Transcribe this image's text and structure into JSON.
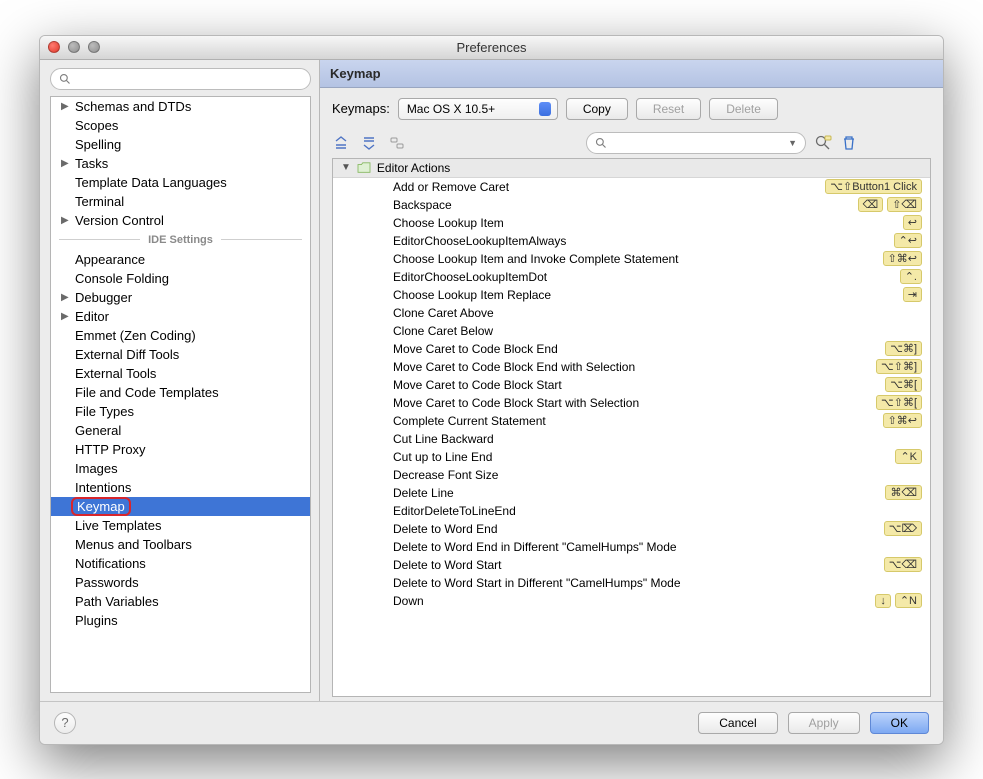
{
  "window": {
    "title": "Preferences"
  },
  "search": {
    "placeholder": ""
  },
  "sidebar": {
    "divider_label": "IDE Settings",
    "items_top": [
      {
        "label": "Schemas and DTDs",
        "arrow": true
      },
      {
        "label": "Scopes",
        "arrow": false
      },
      {
        "label": "Spelling",
        "arrow": false
      },
      {
        "label": "Tasks",
        "arrow": true
      },
      {
        "label": "Template Data Languages",
        "arrow": false
      },
      {
        "label": "Terminal",
        "arrow": false
      },
      {
        "label": "Version Control",
        "arrow": true
      }
    ],
    "items_bottom": [
      {
        "label": "Appearance",
        "arrow": false
      },
      {
        "label": "Console Folding",
        "arrow": false
      },
      {
        "label": "Debugger",
        "arrow": true
      },
      {
        "label": "Editor",
        "arrow": true
      },
      {
        "label": "Emmet (Zen Coding)",
        "arrow": false
      },
      {
        "label": "External Diff Tools",
        "arrow": false
      },
      {
        "label": "External Tools",
        "arrow": false
      },
      {
        "label": "File and Code Templates",
        "arrow": false
      },
      {
        "label": "File Types",
        "arrow": false
      },
      {
        "label": "General",
        "arrow": false
      },
      {
        "label": "HTTP Proxy",
        "arrow": false
      },
      {
        "label": "Images",
        "arrow": false
      },
      {
        "label": "Intentions",
        "arrow": false
      },
      {
        "label": "Keymap",
        "arrow": false,
        "selected": true
      },
      {
        "label": "Live Templates",
        "arrow": false
      },
      {
        "label": "Menus and Toolbars",
        "arrow": false
      },
      {
        "label": "Notifications",
        "arrow": false
      },
      {
        "label": "Passwords",
        "arrow": false
      },
      {
        "label": "Path Variables",
        "arrow": false
      },
      {
        "label": "Plugins",
        "arrow": false
      }
    ]
  },
  "panel": {
    "title": "Keymap",
    "keymaps_label": "Keymaps:",
    "keymaps_value": "Mac OS X 10.5+",
    "copy_btn": "Copy",
    "reset_btn": "Reset",
    "delete_btn": "Delete",
    "group_header": "Editor Actions",
    "actions": [
      {
        "name": "Add or Remove Caret",
        "shortcuts": [
          "⌥⇧Button1 Click"
        ]
      },
      {
        "name": "Backspace",
        "shortcuts": [
          "⌫",
          "⇧⌫"
        ]
      },
      {
        "name": "Choose Lookup Item",
        "shortcuts": [
          "↩"
        ]
      },
      {
        "name": "EditorChooseLookupItemAlways",
        "shortcuts": [
          "⌃↩"
        ]
      },
      {
        "name": "Choose Lookup Item and Invoke Complete Statement",
        "shortcuts": [
          "⇧⌘↩"
        ]
      },
      {
        "name": "EditorChooseLookupItemDot",
        "shortcuts": [
          "⌃."
        ]
      },
      {
        "name": "Choose Lookup Item Replace",
        "shortcuts": [
          "⇥"
        ]
      },
      {
        "name": "Clone Caret Above",
        "shortcuts": []
      },
      {
        "name": "Clone Caret Below",
        "shortcuts": []
      },
      {
        "name": "Move Caret to Code Block End",
        "shortcuts": [
          "⌥⌘]"
        ]
      },
      {
        "name": "Move Caret to Code Block End with Selection",
        "shortcuts": [
          "⌥⇧⌘]"
        ]
      },
      {
        "name": "Move Caret to Code Block Start",
        "shortcuts": [
          "⌥⌘["
        ]
      },
      {
        "name": "Move Caret to Code Block Start with Selection",
        "shortcuts": [
          "⌥⇧⌘["
        ]
      },
      {
        "name": "Complete Current Statement",
        "shortcuts": [
          "⇧⌘↩"
        ]
      },
      {
        "name": "Cut Line Backward",
        "shortcuts": []
      },
      {
        "name": "Cut up to Line End",
        "shortcuts": [
          "⌃K"
        ]
      },
      {
        "name": "Decrease Font Size",
        "shortcuts": []
      },
      {
        "name": "Delete Line",
        "shortcuts": [
          "⌘⌫"
        ]
      },
      {
        "name": "EditorDeleteToLineEnd",
        "shortcuts": []
      },
      {
        "name": "Delete to Word End",
        "shortcuts": [
          "⌥⌦"
        ]
      },
      {
        "name": "Delete to Word End in Different \"CamelHumps\" Mode",
        "shortcuts": []
      },
      {
        "name": "Delete to Word Start",
        "shortcuts": [
          "⌥⌫"
        ]
      },
      {
        "name": "Delete to Word Start in Different \"CamelHumps\" Mode",
        "shortcuts": []
      },
      {
        "name": "Down",
        "shortcuts": [
          "↓",
          "⌃N"
        ]
      }
    ]
  },
  "footer": {
    "cancel": "Cancel",
    "apply": "Apply",
    "ok": "OK"
  }
}
